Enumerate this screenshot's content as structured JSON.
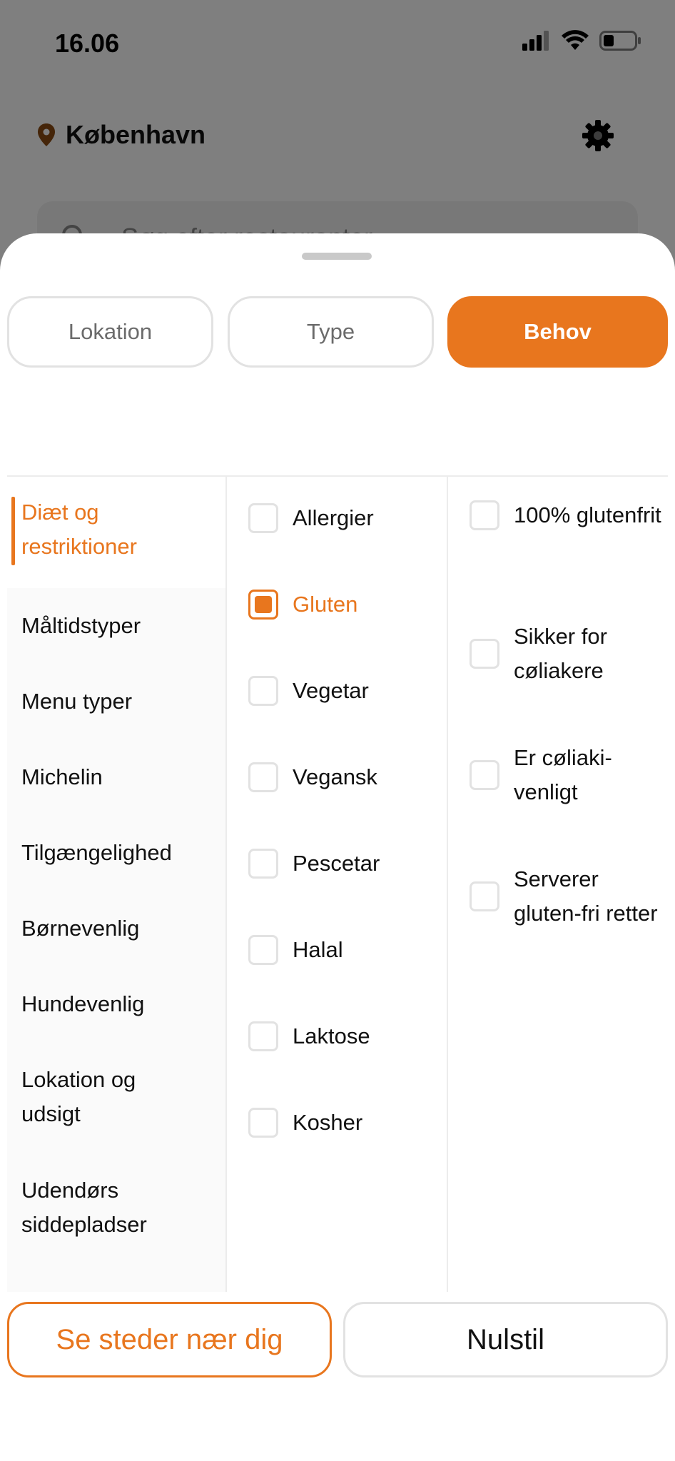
{
  "status_bar": {
    "time": "16.06"
  },
  "background": {
    "location": "København",
    "search_placeholder": "Søg efter restauranter"
  },
  "tabs": [
    {
      "label": "Lokation",
      "active": false
    },
    {
      "label": "Type",
      "active": false
    },
    {
      "label": "Behov",
      "active": true
    }
  ],
  "categories": [
    {
      "label": "Diæt og restriktioner",
      "active": true
    },
    {
      "label": "Måltidstyper",
      "active": false
    },
    {
      "label": "Menu typer",
      "active": false
    },
    {
      "label": "Michelin",
      "active": false
    },
    {
      "label": "Tilgængelighed",
      "active": false
    },
    {
      "label": "Børnevenlig",
      "active": false
    },
    {
      "label": "Hundevenlig",
      "active": false
    },
    {
      "label": "Lokation og udsigt",
      "active": false
    },
    {
      "label": "Udendørs siddepladser",
      "active": false
    }
  ],
  "options": [
    {
      "label": "Allergier",
      "checked": false
    },
    {
      "label": "Gluten",
      "checked": true
    },
    {
      "label": "Vegetar",
      "checked": false
    },
    {
      "label": "Vegansk",
      "checked": false
    },
    {
      "label": "Pescetar",
      "checked": false
    },
    {
      "label": "Halal",
      "checked": false
    },
    {
      "label": "Laktose",
      "checked": false
    },
    {
      "label": "Kosher",
      "checked": false
    }
  ],
  "sub_options": [
    {
      "label": "100% glutenfrit",
      "checked": false
    },
    {
      "label": "Sikker for cøliakere",
      "checked": false
    },
    {
      "label": "Er cøliaki-venligt",
      "checked": false
    },
    {
      "label": "Serverer gluten-fri retter",
      "checked": false
    }
  ],
  "buttons": {
    "primary": "Se steder nær dig",
    "secondary": "Nulstil"
  },
  "colors": {
    "accent": "#e8761e",
    "border": "#e2e2e2"
  }
}
